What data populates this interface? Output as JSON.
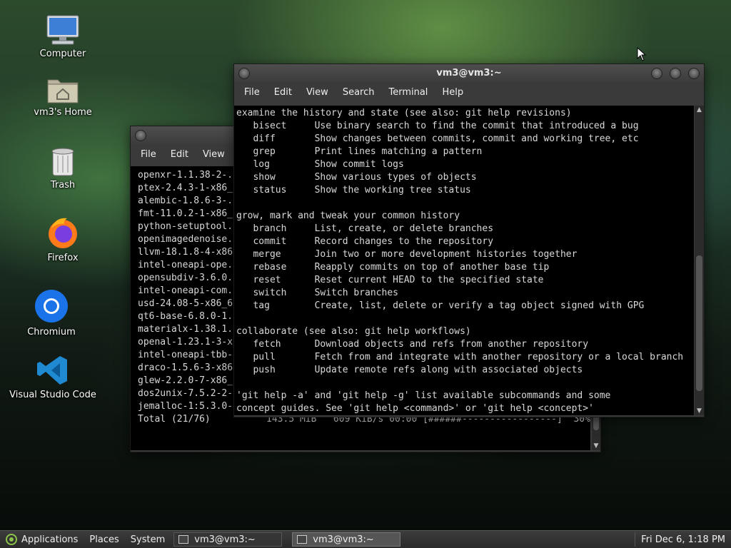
{
  "desktop": {
    "icons": [
      {
        "label": "Computer",
        "icon": "computer-icon"
      },
      {
        "label": "vm3's Home",
        "icon": "home-folder-icon"
      },
      {
        "label": "Trash",
        "icon": "trash-icon"
      },
      {
        "label": "Firefox",
        "icon": "firefox-icon"
      },
      {
        "label": "Chromium",
        "icon": "chromium-icon"
      },
      {
        "label": "Visual Studio Code",
        "icon": "vscode-icon"
      }
    ]
  },
  "back_window": {
    "menu": [
      "File",
      "Edit",
      "View"
    ],
    "lines": [
      "openxr-1.1.38-2-.",
      "ptex-2.4.3-1-x86_",
      "alembic-1.8.6-3-.",
      "fmt-11.0.2-1-x86_",
      "python-setuptool.",
      "openimagedenoise.",
      "llvm-18.1.8-4-x86",
      "intel-oneapi-ope.",
      "opensubdiv-3.6.0.",
      "intel-oneapi-com.",
      "usd-24.08-5-x86_6",
      "qt6-base-6.8.0-1.",
      "materialx-1.38.1.",
      "openal-1.23.1-3-x",
      "intel-oneapi-tbb-",
      "draco-1.5.6-3-x86",
      "glew-2.2.0-7-x86_",
      "dos2unix-7.5.2-2-",
      "jemalloc-1:5.3.0-",
      "Total (21/76)          143.5 MiB   609 KiB/s 00:00 [######-----------------]  30%"
    ]
  },
  "front_window": {
    "title": "vm3@vm3:~",
    "menu": [
      "File",
      "Edit",
      "View",
      "Search",
      "Terminal",
      "Help"
    ],
    "lines": [
      "examine the history and state (see also: git help revisions)",
      "   bisect     Use binary search to find the commit that introduced a bug",
      "   diff       Show changes between commits, commit and working tree, etc",
      "   grep       Print lines matching a pattern",
      "   log        Show commit logs",
      "   show       Show various types of objects",
      "   status     Show the working tree status",
      "",
      "grow, mark and tweak your common history",
      "   branch     List, create, or delete branches",
      "   commit     Record changes to the repository",
      "   merge      Join two or more development histories together",
      "   rebase     Reapply commits on top of another base tip",
      "   reset      Reset current HEAD to the specified state",
      "   switch     Switch branches",
      "   tag        Create, list, delete or verify a tag object signed with GPG",
      "",
      "collaborate (see also: git help workflows)",
      "   fetch      Download objects and refs from another repository",
      "   pull       Fetch from and integrate with another repository or a local branch",
      "   push       Update remote refs along with associated objects",
      "",
      "'git help -a' and 'git help -g' list available subcommands and some",
      "concept guides. See 'git help <command>' or 'git help <concept>'"
    ]
  },
  "taskbar": {
    "applications": "Applications",
    "places": "Places",
    "system": "System",
    "tasks": [
      {
        "label": "vm3@vm3:~",
        "active": false
      },
      {
        "label": "vm3@vm3:~",
        "active": true
      }
    ],
    "clock": "Fri Dec 6, 1:18 PM"
  }
}
